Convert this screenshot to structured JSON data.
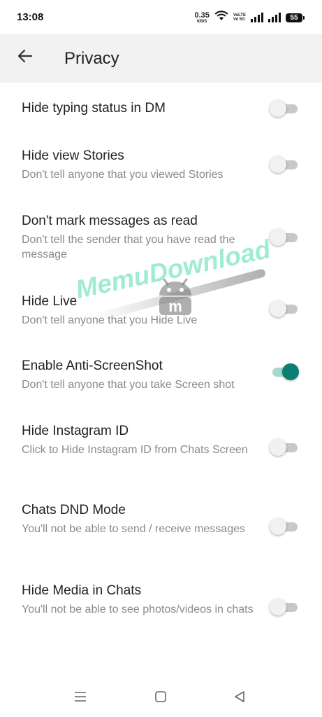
{
  "status_bar": {
    "time": "13:08",
    "net_speed": "0.35",
    "net_unit": "KB/S",
    "volte_1": "VoLTE",
    "volte_2": "Vo 5G",
    "volte_3": "KB",
    "battery": "55"
  },
  "app_bar": {
    "title": "Privacy",
    "back_icon": "arrow-left-icon"
  },
  "settings": [
    {
      "title": "Hide typing status in DM",
      "subtitle": "",
      "enabled": false
    },
    {
      "title": "Hide view Stories",
      "subtitle": "Don't tell anyone that you viewed Stories",
      "enabled": false
    },
    {
      "title": "Don't mark messages as read",
      "subtitle": "Don't tell the sender that you have read the message",
      "enabled": false
    },
    {
      "title": "Hide Live",
      "subtitle": "Don't tell anyone that you Hide Live",
      "enabled": false
    },
    {
      "title": "Enable Anti-ScreenShot",
      "subtitle": "Don't tell anyone that you take Screen shot",
      "enabled": true
    },
    {
      "title": "Hide Instagram ID",
      "subtitle": "Click to Hide Instagram ID from Chats Screen",
      "enabled": false
    },
    {
      "title": "Chats DND Mode",
      "subtitle": "You'll not be able to send / receive messages",
      "enabled": false
    },
    {
      "title": "Hide Media in Chats",
      "subtitle": "You'll not be able to see photos/videos in chats",
      "enabled": false
    }
  ],
  "watermark": {
    "text": "MemuDownload"
  },
  "colors": {
    "accent": "#0b7f71",
    "accent_track": "#a5d8cf",
    "app_bar_bg": "#f2f2f2",
    "subtitle": "#8a8a8a"
  },
  "nav_bar": {
    "icons": [
      "menu-icon",
      "home-square-icon",
      "back-triangle-icon"
    ]
  }
}
